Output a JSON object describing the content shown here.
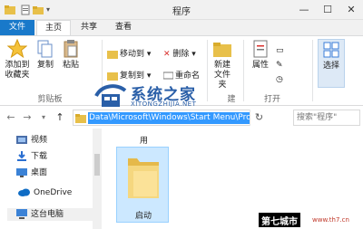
{
  "window": {
    "title": "程序",
    "min": "—",
    "max": "☐",
    "close": "✕"
  },
  "tabs": [
    {
      "id": "file",
      "label": "文件"
    },
    {
      "id": "home",
      "label": "主页"
    },
    {
      "id": "share",
      "label": "共享"
    },
    {
      "id": "view",
      "label": "查看"
    }
  ],
  "ribbon": {
    "pin_label_1": "添加到",
    "pin_label_2": "收藏夹",
    "copy": "复制",
    "paste": "粘贴",
    "clipboard_group": "剪贴板",
    "move_to": "移动到",
    "delete": "删除",
    "copy_to": "复制到",
    "rename": "重命名",
    "new_folder_1": "新建",
    "new_folder_2": "文件夹",
    "properties": "属性",
    "open_group": "打开",
    "select": "选择",
    "partial_group": "建"
  },
  "watermark": {
    "title": "系统之家",
    "subtitle": "XITONGZHIJIA.NET"
  },
  "address": {
    "path": "Data\\Microsoft\\Windows\\Start Menu\\Progra",
    "refresh": "↻",
    "search_placeholder": "搜索\"程序\""
  },
  "nav": {
    "back": "←",
    "forward": "→",
    "up": "↑",
    "items": [
      {
        "label": "视频",
        "icon": "video-icon"
      },
      {
        "label": "下载",
        "icon": "download-icon"
      },
      {
        "label": "桌面",
        "icon": "desktop-icon"
      },
      {
        "label": "OneDrive",
        "icon": "cloud-icon"
      },
      {
        "label": "这台电脑",
        "icon": "pc-icon"
      }
    ]
  },
  "content": {
    "partial_label": "用",
    "folder": {
      "name": "启动"
    }
  },
  "badge": {
    "text": "第七城市",
    "url": "www.th7.cn"
  },
  "colors": {
    "accent": "#1979ca",
    "selection": "#3399ff",
    "watermark": "#2a5fa8"
  }
}
